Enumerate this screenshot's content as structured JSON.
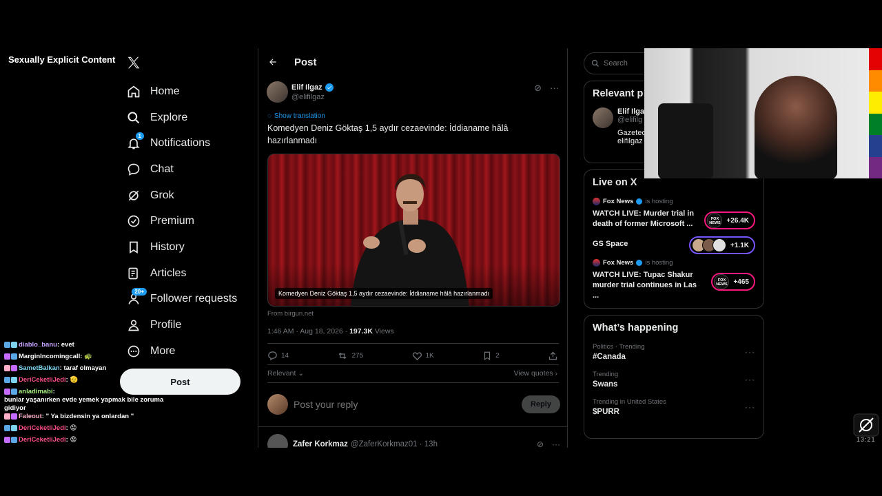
{
  "overlay_label": "Sexually Explicit Content",
  "nav": {
    "items": [
      {
        "label": "Home",
        "icon": "home-icon"
      },
      {
        "label": "Explore",
        "icon": "search-icon"
      },
      {
        "label": "Notifications",
        "icon": "bell-icon",
        "badge": "1"
      },
      {
        "label": "Chat",
        "icon": "chat-icon"
      },
      {
        "label": "Grok",
        "icon": "grok-icon"
      },
      {
        "label": "Premium",
        "icon": "verified-icon"
      },
      {
        "label": "History",
        "icon": "bookmark-icon"
      },
      {
        "label": "Articles",
        "icon": "article-icon"
      },
      {
        "label": "Follower requests",
        "icon": "person-add-icon",
        "badge": "20+"
      },
      {
        "label": "Profile",
        "icon": "person-icon"
      },
      {
        "label": "More",
        "icon": "more-circle-icon"
      }
    ],
    "post_button": "Post"
  },
  "chat": [
    {
      "user": "diablo_banu",
      "color": "#c8a2ff",
      "msg": "evet"
    },
    {
      "user": "MarginIncomingcall",
      "color": "#ffffff",
      "msg": "🐢"
    },
    {
      "user": "SametBalkan",
      "color": "#7ed4f0",
      "msg": "taraf olmayan"
    },
    {
      "user": "DeriCeketliJedi",
      "color": "#ff4f8b",
      "msg": "🫡"
    },
    {
      "user": "anladimabi",
      "color": "#a6f07e",
      "msg": "bunlar yaşanırken evde yemek yapmak bile zoruma gidiyor"
    },
    {
      "user": "Faleout",
      "color": "#ffb0c8",
      "msg": "\" Ya bizdensin ya onlardan \""
    },
    {
      "user": "DeriCeketliJedi",
      "color": "#ff4f8b",
      "msg": "😡"
    },
    {
      "user": "DeriCeketliJedi",
      "color": "#ff4f8b",
      "msg": "😡"
    }
  ],
  "post": {
    "header_title": "Post",
    "author_name": "Elif Ilgaz",
    "author_handle": "@elifilgaz",
    "translate": "Show translation",
    "text": "Komedyen Deniz Göktaş 1,5 aydır cezaevinde: İddianame hâlâ hazırlanmadı",
    "media_caption": "Komedyen Deniz Göktaş 1,5 aydır cezaevinde: İddianame hâlâ hazırlanmadı",
    "source": "From birgun.net",
    "time": "1:46 AM · Aug 18, 2026 · ",
    "views_count": "197.3K",
    "views_label": " Views",
    "replies": "14",
    "reposts": "275",
    "likes": "1K",
    "bookmarks": "2",
    "sort": "Relevant",
    "view_quotes": "View quotes",
    "reply_placeholder": "Post your reply",
    "reply_button": "Reply"
  },
  "next_reply": {
    "name": "Zafer Korkmaz",
    "handle": "@ZaferKorkmaz01 · 13h"
  },
  "sidebar": {
    "search_placeholder": "Search",
    "relevant_title": "Relevant p",
    "relevant_user": {
      "name": "Elif Ilga",
      "handle": "@elifilg",
      "bio1": "Gazeteci",
      "bio2": "elifilgaz"
    },
    "live_title": "Live on X",
    "live": [
      {
        "host": "Fox News",
        "suffix": "is hosting",
        "title": "WATCH LIVE: Murder trial in death of former Microsoft ...",
        "count": "+26.4K",
        "style": "fox"
      },
      {
        "host": "",
        "suffix": "",
        "title": "GS Space",
        "count": "+1.1K",
        "style": "faces"
      },
      {
        "host": "Fox News",
        "suffix": "is hosting",
        "title": "WATCH LIVE: Tupac Shakur murder trial continues in Las ...",
        "count": "+465",
        "style": "fox"
      }
    ],
    "happening_title": "What’s happening",
    "trends": [
      {
        "ctx": "Politics · Trending",
        "title": "#Canada"
      },
      {
        "ctx": "Trending",
        "title": "Swans"
      },
      {
        "ctx": "Trending in United States",
        "title": "$PURR"
      }
    ]
  },
  "stream_clock": "13:21",
  "colors": {
    "accent": "#1d9bf0",
    "live": "#f91880",
    "background": "#000000"
  }
}
